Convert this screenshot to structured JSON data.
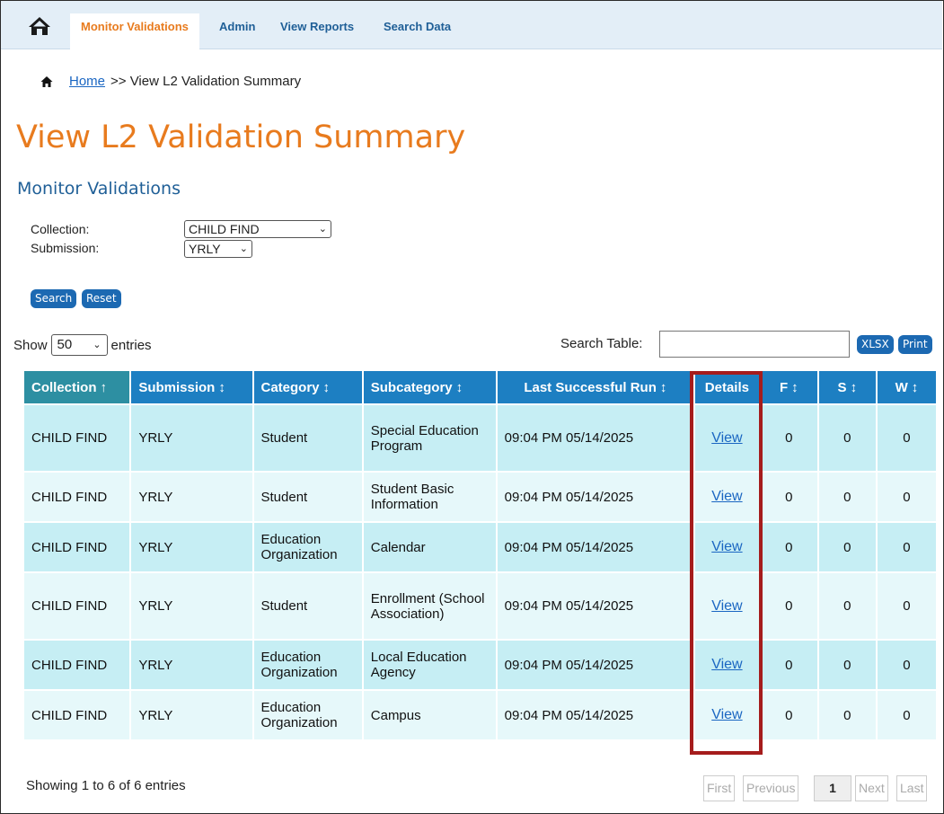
{
  "nav": {
    "tabs": [
      {
        "label": "Monitor Validations",
        "active": true
      },
      {
        "label": "Admin",
        "active": false
      },
      {
        "label": "View Reports",
        "active": false
      },
      {
        "label": "Search Data",
        "active": false
      }
    ]
  },
  "breadcrumb": {
    "home_link": "Home",
    "separator": ">> View L2 Validation Summary"
  },
  "page": {
    "title": "View L2 Validation Summary",
    "subtitle": "Monitor Validations"
  },
  "filters": {
    "collection_label": "Collection:",
    "collection_value": "CHILD FIND",
    "submission_label": "Submission:",
    "submission_value": "YRLY",
    "search_button": "Search",
    "reset_button": "Reset"
  },
  "table_controls": {
    "show_label": "Show",
    "length_value": "50",
    "entries_label": "entries",
    "search_label": "Search Table:",
    "search_value": "",
    "xlsx_button": "XLSX",
    "print_button": "Print"
  },
  "table": {
    "headers": [
      "Collection",
      "Submission",
      "Category",
      "Subcategory",
      "Last Successful Run",
      "Details",
      "F",
      "S",
      "W"
    ],
    "rows": [
      {
        "collection": "CHILD FIND",
        "submission": "YRLY",
        "category": "Student",
        "subcategory": "Special Education Program",
        "last_run": "09:04 PM 05/14/2025",
        "details": "View",
        "f": "0",
        "s": "0",
        "w": "0"
      },
      {
        "collection": "CHILD FIND",
        "submission": "YRLY",
        "category": "Student",
        "subcategory": "Student Basic Information",
        "last_run": "09:04 PM 05/14/2025",
        "details": "View",
        "f": "0",
        "s": "0",
        "w": "0"
      },
      {
        "collection": "CHILD FIND",
        "submission": "YRLY",
        "category": "Education Organization",
        "subcategory": "Calendar",
        "last_run": "09:04 PM 05/14/2025",
        "details": "View",
        "f": "0",
        "s": "0",
        "w": "0"
      },
      {
        "collection": "CHILD FIND",
        "submission": "YRLY",
        "category": "Student",
        "subcategory": "Enrollment (School Association)",
        "last_run": "09:04 PM 05/14/2025",
        "details": "View",
        "f": "0",
        "s": "0",
        "w": "0"
      },
      {
        "collection": "CHILD FIND",
        "submission": "YRLY",
        "category": "Education Organization",
        "subcategory": "Local Education Agency",
        "last_run": "09:04 PM 05/14/2025",
        "details": "View",
        "f": "0",
        "s": "0",
        "w": "0"
      },
      {
        "collection": "CHILD FIND",
        "submission": "YRLY",
        "category": "Education Organization",
        "subcategory": "Campus",
        "last_run": "09:04 PM 05/14/2025",
        "details": "View",
        "f": "0",
        "s": "0",
        "w": "0"
      }
    ]
  },
  "footer": {
    "info": "Showing 1 to 6 of 6 entries",
    "pager": {
      "first": "First",
      "previous": "Previous",
      "current": "1",
      "next": "Next",
      "last": "Last"
    }
  },
  "colors": {
    "accent_orange": "#e87b1e",
    "header_blue": "#1d7fc2",
    "highlight_red": "#a51c1c"
  },
  "icons": {
    "home": "home-icon",
    "sort": "sort-arrows-icon"
  }
}
